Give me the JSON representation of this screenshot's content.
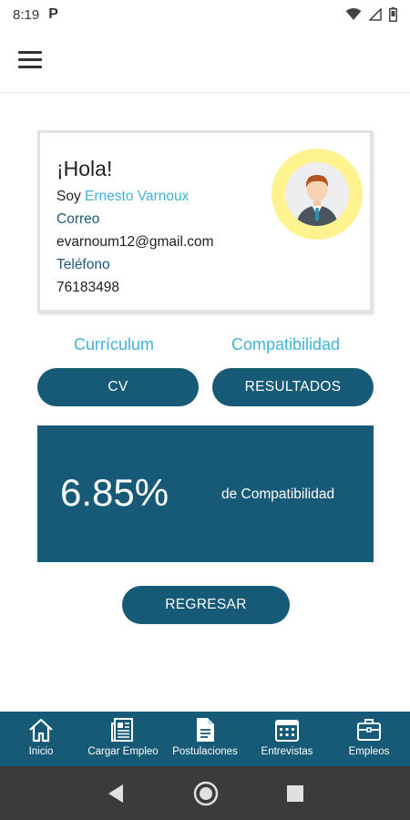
{
  "status_bar": {
    "time": "8:19",
    "app_badge": "P"
  },
  "profile": {
    "greeting": "¡Hola!",
    "soy_prefix": "Soy",
    "name": "Ernesto Varnoux",
    "email_label": "Correo",
    "email": "evarnoum12@gmail.com",
    "phone_label": "Teléfono",
    "phone": "76183498"
  },
  "sections": {
    "curriculum_label": "Currículum",
    "compat_label": "Compatibilidad"
  },
  "buttons": {
    "cv": "CV",
    "resultados": "RESULTADOS",
    "regresar": "REGRESAR"
  },
  "compatibility": {
    "value": "6.85%",
    "text": "de Compatibilidad"
  },
  "bottom_nav": [
    {
      "label": "Inicio",
      "icon": "home-icon"
    },
    {
      "label": "Cargar Empleo",
      "icon": "newspaper-icon"
    },
    {
      "label": "Postulaciones",
      "icon": "document-icon"
    },
    {
      "label": "Entrevistas",
      "icon": "calendar-icon"
    },
    {
      "label": "Empleos",
      "icon": "briefcase-icon"
    }
  ],
  "colors": {
    "primary": "#165a77",
    "accent": "#42b3d8",
    "avatar_ring": "#fff38f"
  }
}
